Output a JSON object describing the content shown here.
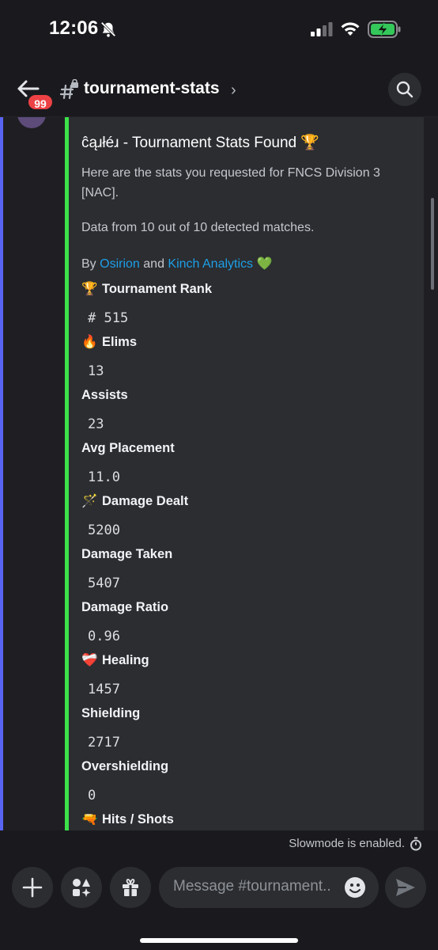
{
  "status_bar": {
    "time": "12:06",
    "icons": [
      "bell-slash-icon",
      "cellular-signal-icon",
      "wifi-icon",
      "battery-charging-icon"
    ]
  },
  "header": {
    "back_icon": "arrow-left-icon",
    "unread_badge": "99",
    "channel_icon": "locked-hash-icon",
    "channel_name": "tournament-stats",
    "chevron": "›",
    "search_icon": "search-icon"
  },
  "embed": {
    "accent_color": "#3ce24a",
    "title": "ĉąɹłéɹ - Tournament Stats Found 🏆",
    "description_line1": "Here are the stats you requested for FNCS Division 3 [NAC].",
    "description_line2": "Data from 10 out of 10 detected matches.",
    "by_prefix": "By",
    "link1": "Osirion",
    "and_text": "and",
    "link2": "Kinch Analytics",
    "heart": "💚",
    "fields": [
      {
        "emoji": "🏆",
        "name": "Tournament Rank",
        "value": "# 515"
      },
      {
        "emoji": "🔥",
        "name": "Elims",
        "value": "13"
      },
      {
        "emoji": "",
        "name": "Assists",
        "value": "23"
      },
      {
        "emoji": "",
        "name": "Avg Placement",
        "value": "11.0"
      },
      {
        "emoji": "🪄",
        "name": "Damage Dealt",
        "value": "5200"
      },
      {
        "emoji": "",
        "name": "Damage Taken",
        "value": "5407"
      },
      {
        "emoji": "",
        "name": "Damage Ratio",
        "value": "0.96"
      },
      {
        "emoji": "❤️‍🩹",
        "name": "Healing",
        "value": "1457"
      },
      {
        "emoji": "",
        "name": "Shielding",
        "value": "2717"
      },
      {
        "emoji": "",
        "name": "Overshielding",
        "value": "0"
      },
      {
        "emoji": "🔫",
        "name": "Hits / Shots",
        "value": ""
      }
    ]
  },
  "footer": {
    "slowmode_text": "Slowmode is enabled.",
    "slowmode_icon": "stopwatch-icon",
    "add_icon": "plus-icon",
    "apps_icon": "apps-icon",
    "gift_icon": "gift-icon",
    "message_placeholder": "Message #tournament..",
    "emoji_icon": "emoji-icon",
    "send_icon": "send-icon"
  },
  "colors": {
    "background": "#1a1a1e",
    "embed_bg": "#2b2d31",
    "link": "#1e9fe6",
    "badge": "#ed4245",
    "left_accent": "#5865f2"
  }
}
